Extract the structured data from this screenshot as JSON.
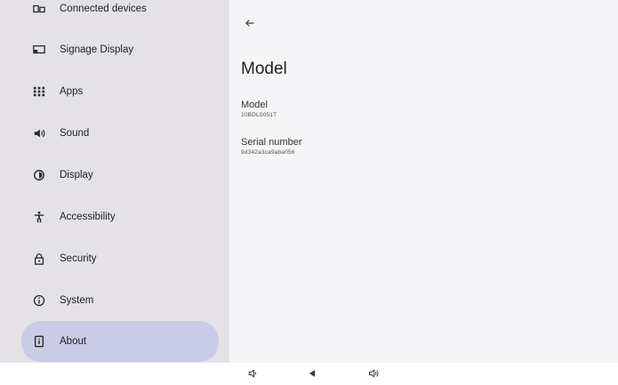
{
  "sidebar": {
    "items": [
      {
        "label": "Connected devices",
        "icon": "connected-devices-icon"
      },
      {
        "label": "Signage Display",
        "icon": "signage-display-icon"
      },
      {
        "label": "Apps",
        "icon": "apps-grid-icon"
      },
      {
        "label": "Sound",
        "icon": "volume-icon"
      },
      {
        "label": "Display",
        "icon": "brightness-icon"
      },
      {
        "label": "Accessibility",
        "icon": "accessibility-icon"
      },
      {
        "label": "Security",
        "icon": "lock-icon"
      },
      {
        "label": "System",
        "icon": "info-circle-icon"
      },
      {
        "label": "About",
        "icon": "device-info-icon",
        "selected": true
      }
    ]
  },
  "detail": {
    "title": "Model",
    "prefs": [
      {
        "title": "Model",
        "summary": "10BDL5051T"
      },
      {
        "title": "Serial number",
        "summary": "9d342a3ca9aba056"
      }
    ]
  },
  "navbar": {
    "buttons": [
      "volume-down-icon",
      "back-triangle-icon",
      "volume-up-icon"
    ]
  },
  "colors": {
    "sidebar_bg": "#e4e2e6",
    "selected_bg": "#c9cce4",
    "detail_bg": "#f5f4f6"
  }
}
